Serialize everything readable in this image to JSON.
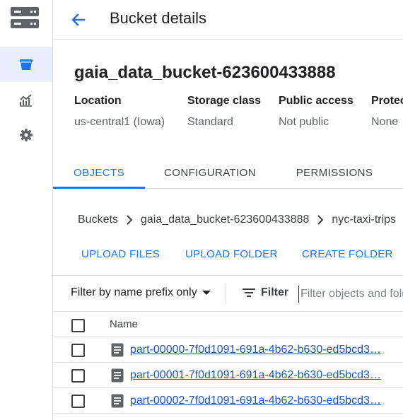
{
  "header": {
    "title": "Bucket details"
  },
  "bucket": {
    "name": "gaia_data_bucket-623600433888",
    "meta": [
      {
        "label": "Location",
        "value": "us-central1 (Iowa)"
      },
      {
        "label": "Storage class",
        "value": "Standard"
      },
      {
        "label": "Public access",
        "value": "Not public"
      },
      {
        "label": "Protec",
        "value": "None"
      }
    ]
  },
  "tabs": [
    {
      "label": "OBJECTS",
      "active": true
    },
    {
      "label": "CONFIGURATION",
      "active": false
    },
    {
      "label": "PERMISSIONS",
      "active": false
    }
  ],
  "breadcrumb": [
    "Buckets",
    "gaia_data_bucket-623600433888",
    "nyc-taxi-trips"
  ],
  "actions": {
    "upload_files": "UPLOAD FILES",
    "upload_folder": "UPLOAD FOLDER",
    "create_folder": "CREATE FOLDER"
  },
  "filter": {
    "prefix_select": "Filter by name prefix only",
    "filter_label": "Filter",
    "input_placeholder": "Filter objects and folders",
    "input_value": ""
  },
  "table": {
    "columns": [
      "Name"
    ],
    "rows": [
      {
        "name": "part-00000-7f0d1091-691a-4b62-b630-ed5bcd3…"
      },
      {
        "name": "part-00001-7f0d1091-691a-4b62-b630-ed5bcd3…"
      },
      {
        "name": "part-00002-7f0d1091-691a-4b62-b630-ed5bcd3…"
      }
    ]
  },
  "icons": {
    "logo": "storage-logo-icon",
    "nav": [
      "bucket-icon",
      "monitoring-chart-icon",
      "settings-gear-icon"
    ],
    "back": "arrow-back-icon",
    "breadcrumb_sep": "chevron-right-icon",
    "dropdown": "caret-down-icon",
    "filter": "filter-lines-icon",
    "file": "document-icon"
  },
  "colors": {
    "accent": "#1a73e8",
    "active_nav_bg": "#e8f0fe",
    "link": "#1a56c8"
  }
}
